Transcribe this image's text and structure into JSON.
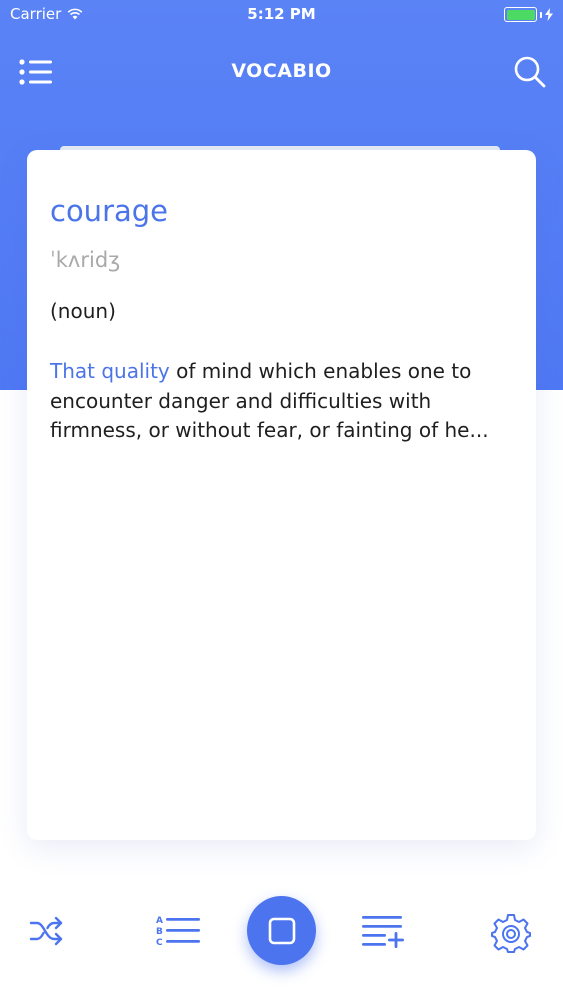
{
  "status_bar": {
    "carrier": "Carrier",
    "time": "5:12 PM"
  },
  "nav": {
    "title": "VOCABIO",
    "menu_icon": "list-icon",
    "search_icon": "search-icon"
  },
  "card": {
    "word": "courage",
    "phonetic": "ˈkʌridʒ",
    "part_of_speech": "(noun)",
    "definition_highlight": "That quality",
    "definition_rest": " of mind which enables one to encounter danger and difficulties with firmness, or without fear, or fainting of he..."
  },
  "toolbar": {
    "items": [
      "shuffle-icon",
      "alphabetical-list-icon",
      "flashcard-icon",
      "add-to-list-icon",
      "settings-gear-icon"
    ]
  },
  "colors": {
    "accent": "#4c74ef",
    "header": "#5a83f6",
    "battery": "#4cd964"
  }
}
